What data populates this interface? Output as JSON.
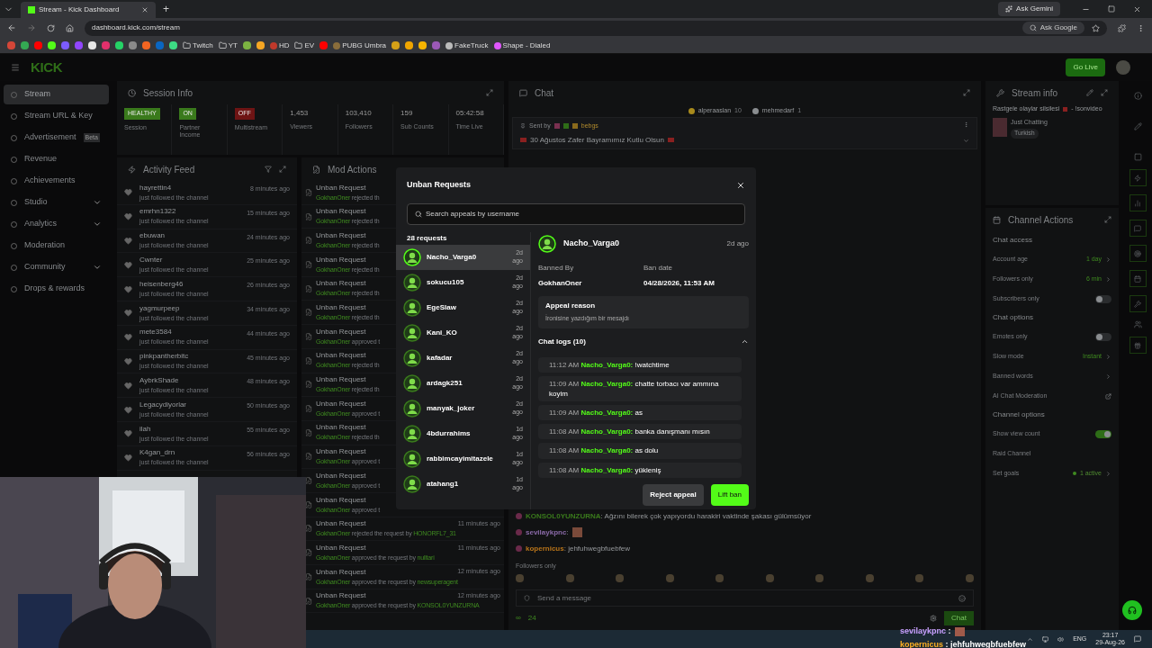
{
  "browser": {
    "tab_title": "Stream - Kick Dashboard",
    "new_tab": "+",
    "ask_gemini": "Ask Gemini",
    "url": "dashboard.kick.com/stream",
    "ask_google": "Ask Google",
    "bookmarks": [
      {
        "kind": "icon",
        "color": "#d44638"
      },
      {
        "kind": "icon",
        "color": "#34a853"
      },
      {
        "kind": "icon",
        "color": "#ff0000"
      },
      {
        "kind": "icon",
        "color": "#53fc18"
      },
      {
        "kind": "icon",
        "color": "#7c5cff"
      },
      {
        "kind": "icon",
        "color": "#9146ff"
      },
      {
        "kind": "icon",
        "color": "#e6e6e6"
      },
      {
        "kind": "icon",
        "color": "#e1306c"
      },
      {
        "kind": "icon",
        "color": "#25d366"
      },
      {
        "kind": "icon",
        "color": "#8a8a8a"
      },
      {
        "kind": "icon",
        "color": "#f26522"
      },
      {
        "kind": "icon",
        "color": "#0a66c2"
      },
      {
        "kind": "icon",
        "color": "#3ddc84"
      },
      {
        "kind": "folder",
        "label": "Twitch"
      },
      {
        "kind": "folder",
        "label": "YT"
      },
      {
        "kind": "icon",
        "color": "#7cb342"
      },
      {
        "kind": "icon",
        "color": "#f5a623"
      },
      {
        "kind": "site",
        "label": "HD",
        "color": "#c0392b"
      },
      {
        "kind": "folder",
        "label": "EV"
      },
      {
        "kind": "icon",
        "color": "#ff0000"
      },
      {
        "kind": "site",
        "label": "PUBG Umbra",
        "color": "#8a6d3b"
      },
      {
        "kind": "icon",
        "color": "#d4a017"
      },
      {
        "kind": "icon",
        "color": "#f0a500"
      },
      {
        "kind": "icon",
        "color": "#f7b500"
      },
      {
        "kind": "icon",
        "color": "#9b59b6"
      },
      {
        "kind": "site",
        "label": "FakeTruck",
        "color": "#bbbbbb"
      },
      {
        "kind": "site",
        "label": "Shape - Dialed",
        "color": "#e056fd"
      }
    ]
  },
  "header": {
    "logo": "KICK",
    "go_live": "Go Live"
  },
  "sidebar": {
    "items": [
      {
        "label": "Stream",
        "selected": true,
        "expandable": false
      },
      {
        "label": "Stream URL & Key",
        "selected": false,
        "expandable": false
      },
      {
        "label": "Advertisement",
        "badge": "Beta",
        "selected": false,
        "expandable": false
      },
      {
        "label": "Revenue",
        "selected": false,
        "expandable": false
      },
      {
        "label": "Achievements",
        "selected": false,
        "expandable": false
      },
      {
        "label": "Studio",
        "selected": false,
        "expandable": true
      },
      {
        "label": "Analytics",
        "selected": false,
        "expandable": true
      },
      {
        "label": "Moderation",
        "selected": false,
        "expandable": false
      },
      {
        "label": "Community",
        "selected": false,
        "expandable": true
      },
      {
        "label": "Drops & rewards",
        "selected": false,
        "expandable": false
      }
    ]
  },
  "session_info": {
    "title": "Session Info",
    "stats": [
      {
        "kind": "badge",
        "value": "HEALTHY",
        "label": "Session",
        "color": "#3a7a1c"
      },
      {
        "kind": "badge",
        "value": "ON",
        "label": "Partner Income",
        "color": "#3a7a1c"
      },
      {
        "kind": "badge",
        "value": "OFF",
        "label": "Multistream",
        "color": "#6e1414"
      },
      {
        "kind": "number",
        "value": "1,453",
        "label": "Viewers"
      },
      {
        "kind": "number",
        "value": "103,410",
        "label": "Followers"
      },
      {
        "kind": "number",
        "value": "159",
        "label": "Sub Counts"
      },
      {
        "kind": "number",
        "value": "05:42:58",
        "label": "Time Live"
      }
    ]
  },
  "activity_feed": {
    "title": "Activity Feed",
    "items": [
      {
        "user": "hayrettin4",
        "text": "just followed the channel",
        "time": "8 minutes ago"
      },
      {
        "user": "emrhn1322",
        "text": "just followed the channel",
        "time": "15 minutes ago"
      },
      {
        "user": "ebuwan",
        "text": "just followed the channel",
        "time": "24 minutes ago"
      },
      {
        "user": "Cwnter",
        "text": "just followed the channel",
        "time": "25 minutes ago"
      },
      {
        "user": "heisenberg46",
        "text": "just followed the channel",
        "time": "26 minutes ago"
      },
      {
        "user": "yagmurpeep",
        "text": "just followed the channel",
        "time": "34 minutes ago"
      },
      {
        "user": "mete3584",
        "text": "just followed the channel",
        "time": "44 minutes ago"
      },
      {
        "user": "pinkpantherbitc",
        "text": "just followed the channel",
        "time": "45 minutes ago"
      },
      {
        "user": "AybrkShade",
        "text": "just followed the channel",
        "time": "48 minutes ago"
      },
      {
        "user": "Legacydiyorlar",
        "text": "just followed the channel",
        "time": "50 minutes ago"
      },
      {
        "user": "ilah",
        "text": "just followed the channel",
        "time": "55 minutes ago"
      },
      {
        "user": "K4gan_drn",
        "text": "just followed the channel",
        "time": "56 minutes ago"
      }
    ]
  },
  "mod_actions": {
    "title": "Mod Actions",
    "items": [
      {
        "title": "Unban Request",
        "user": "GokhanOner",
        "action": "rejected th"
      },
      {
        "title": "Unban Request",
        "user": "GokhanOner",
        "action": "rejected th"
      },
      {
        "title": "Unban Request",
        "user": "GokhanOner",
        "action": "rejected th"
      },
      {
        "title": "Unban Request",
        "user": "GokhanOner",
        "action": "rejected th"
      },
      {
        "title": "Unban Request",
        "user": "GokhanOner",
        "action": "rejected th"
      },
      {
        "title": "Unban Request",
        "user": "GokhanOner",
        "action": "rejected th"
      },
      {
        "title": "Unban Request",
        "user": "GokhanOner",
        "action": "approved t"
      },
      {
        "title": "Unban Request",
        "user": "GokhanOner",
        "action": "rejected th"
      },
      {
        "title": "Unban Request",
        "user": "GokhanOner",
        "action": "rejected th"
      },
      {
        "title": "Unban Request",
        "user": "GokhanOner",
        "action": "approved t"
      },
      {
        "title": "Unban Request",
        "user": "GokhanOner",
        "action": "rejected th"
      },
      {
        "title": "Unban Request",
        "user": "GokhanOner",
        "action": "approved t"
      },
      {
        "title": "Unban Request",
        "user": "GokhanOner",
        "action": "approved t"
      },
      {
        "title": "Unban Request",
        "user": "GokhanOner",
        "action": "approved t"
      },
      {
        "title": "Unban Request",
        "user": "GokhanOner",
        "action": "rejected the request by",
        "target": "HONORFL7_31",
        "time": "11 minutes ago"
      },
      {
        "title": "Unban Request",
        "user": "GokhanOner",
        "action": "approved the request by",
        "target": "nulltari",
        "time": "11 minutes ago"
      },
      {
        "title": "Unban Request",
        "user": "GokhanOner",
        "action": "approved the request by",
        "target": "newsuperagent",
        "time": "12 minutes ago"
      },
      {
        "title": "Unban Request",
        "user": "GokhanOner",
        "action": "approved the request by",
        "target": "KONSOL0YUNZURNA",
        "time": "12 minutes ago"
      }
    ]
  },
  "chat": {
    "title": "Chat",
    "top_chatters": [
      {
        "name": "alperaaslan",
        "count": "10",
        "color": "#a88a1c"
      },
      {
        "name": "mehmedarf",
        "count": "1",
        "color": "#8a8d90"
      }
    ],
    "pinned": {
      "sent_by": "Sent by",
      "sender": "bebgs",
      "message": "30 Ağustos Zafer Bayramımız Kutlu Olsun"
    },
    "messages": [
      {
        "kind": "text",
        "user": "KONSOL0YUNZURNA",
        "sep": ":",
        "color": "#3a7a1c",
        "text": "Ağzını bilerek çok yapıyordu harakiri vaktinde şakası gülümsüyor"
      },
      {
        "kind": "emote",
        "user": "sevilaykpnc",
        "sep": ":",
        "color": "#8a6aa8"
      },
      {
        "kind": "text",
        "user": "kopernicus",
        "sep": ":",
        "color": "#b8741a",
        "text": "jehfuhwegbfuebfew"
      }
    ],
    "followers_only": "Followers only",
    "placeholder": "Send a message",
    "infinity": "∞",
    "viewers": "24",
    "send": "Chat"
  },
  "stream_info": {
    "title": "Stream info",
    "stream_title": "Rastgele olaylar silsilesi",
    "stream_title_suffix": "- !sonvideo",
    "category": "Just Chatting",
    "tag": "Turkish"
  },
  "channel_actions": {
    "title": "Channel Actions",
    "sections": [
      {
        "heading": "Chat access",
        "rows": [
          {
            "kind": "value",
            "label": "Account age",
            "value": "1 day"
          },
          {
            "kind": "value",
            "label": "Followers only",
            "value": "6 min"
          },
          {
            "kind": "toggle",
            "label": "Subscribers only",
            "on": false
          }
        ]
      },
      {
        "heading": "Chat options",
        "rows": [
          {
            "kind": "toggle",
            "label": "Emotes only",
            "on": false
          },
          {
            "kind": "value",
            "label": "Slow mode",
            "value": "Instant"
          },
          {
            "kind": "link",
            "label": "Banned words"
          },
          {
            "kind": "external",
            "label": "AI Chat Moderation"
          }
        ]
      },
      {
        "heading": "Channel options",
        "rows": [
          {
            "kind": "toggle",
            "label": "Show view count",
            "on": true
          },
          {
            "kind": "plain",
            "label": "Raid Channel"
          },
          {
            "kind": "goal",
            "label": "Set goals",
            "value": "1 active"
          }
        ]
      }
    ]
  },
  "modal": {
    "title": "Unban Requests",
    "search_placeholder": "Search appeals by username",
    "count": "28 requests",
    "requests": [
      {
        "user": "Nacho_Varga0",
        "time": "2d ago",
        "selected": true
      },
      {
        "user": "sokucu105",
        "time": "2d ago",
        "selected": false
      },
      {
        "user": "EgeSlaw",
        "time": "2d ago",
        "selected": false
      },
      {
        "user": "Kani_KO",
        "time": "2d ago",
        "selected": false
      },
      {
        "user": "kafadar",
        "time": "2d ago",
        "selected": false
      },
      {
        "user": "ardagk251",
        "time": "2d ago",
        "selected": false
      },
      {
        "user": "manyak_joker",
        "time": "2d ago",
        "selected": false
      },
      {
        "user": "4bdurrahims",
        "time": "1d ago",
        "selected": false
      },
      {
        "user": "rabbimcayimitazele",
        "time": "1d ago",
        "selected": false
      },
      {
        "user": "atahang1",
        "time": "1d ago",
        "selected": false
      }
    ],
    "detail": {
      "user": "Nacho_Varga0",
      "time": "2d ago",
      "banned_by_label": "Banned By",
      "banned_by": "GokhanOner",
      "ban_date_label": "Ban date",
      "ban_date": "04/28/2026, 11:53 AM",
      "appeal_label": "Appeal reason",
      "appeal": "İronisine yazdığım bir mesajdı",
      "logs_title": "Chat logs (10)",
      "logs_expanded": true,
      "logs": [
        {
          "time": "11:12 AM",
          "user": "Nacho_Varga0:",
          "text": "!watchtime"
        },
        {
          "time": "11:09 AM",
          "user": "Nacho_Varga0:",
          "text": "chatte torbacı var ammına koyim"
        },
        {
          "time": "11:09 AM",
          "user": "Nacho_Varga0:",
          "text": "as"
        },
        {
          "time": "11:08 AM",
          "user": "Nacho_Varga0:",
          "text": "banka danışmanı mısın"
        },
        {
          "time": "11:08 AM",
          "user": "Nacho_Varga0:",
          "text": "as dolu"
        },
        {
          "time": "11:08 AM",
          "user": "Nacho_Varga0:",
          "text": "yükleniş"
        }
      ]
    },
    "reject": "Reject appeal",
    "lift": "Lift ban"
  },
  "stream_overlay": [
    {
      "kind": "emote",
      "user": "sevilaykpnc",
      "sep": ":",
      "color": "#c9a0ff"
    },
    {
      "kind": "text",
      "user": "kopernicus",
      "sep": ":",
      "text": "jehfuhwegbfuebfew",
      "color": "#ffb020"
    }
  ],
  "taskbar": {
    "lang": "ENG",
    "time": "23:17",
    "date": "29-Aug-26"
  }
}
